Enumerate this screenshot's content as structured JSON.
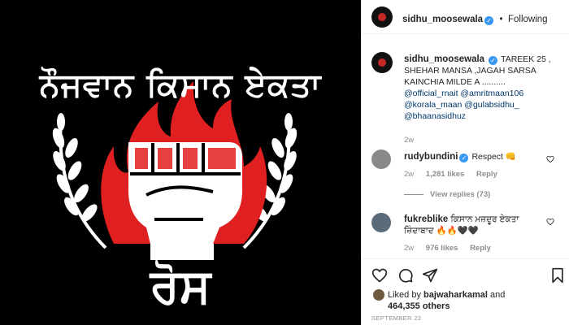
{
  "post_image": {
    "headline": "ਨੌਜਵਾਨ ਕਿਸਾਨ ਏਕਤਾ",
    "bottom_text": "ਰੋਸ",
    "colors": {
      "background": "#000000",
      "flame": "#e02020",
      "fist": "#ffffff"
    }
  },
  "header": {
    "username": "sidhu_moosewala",
    "separator": "•",
    "follow_status": "Following",
    "verified_icon": "verified-badge-icon"
  },
  "caption": {
    "username": "sidhu_moosewala",
    "text": "TAREEK 25 , SHEHAR MANSA ,JAGAH SARSA KAINCHIA MILDE A ..........",
    "tags": [
      "@official_rnait",
      "@amritmaan106",
      "@korala_maan",
      "@gulabsidhu_",
      "@bhaanasidhuz"
    ],
    "time": "2w"
  },
  "comments": [
    {
      "username": "rudybundini",
      "text": "Respect 👊",
      "time": "2w",
      "likes": "1,281 likes",
      "reply": "Reply",
      "view_replies": "View replies (73)"
    },
    {
      "username": "fukreblike",
      "text": "ਕਿਸਾਨ ਮਜ਼ਦੂਰ ਏਕਤਾ ਜ਼ਿੰਦਾਬਾਦ 🔥🔥🖤🖤",
      "time": "2w",
      "likes": "976 likes",
      "reply": "Reply"
    }
  ],
  "likes": {
    "prefix": "Liked by",
    "user": "bajwaharkamal",
    "and": "and",
    "count": "464,355 others"
  },
  "date": "SEPTEMBER 22",
  "colors": {
    "accent_blue": "#3897f0",
    "tag_blue": "#00376b",
    "muted": "#8e8e8e"
  }
}
